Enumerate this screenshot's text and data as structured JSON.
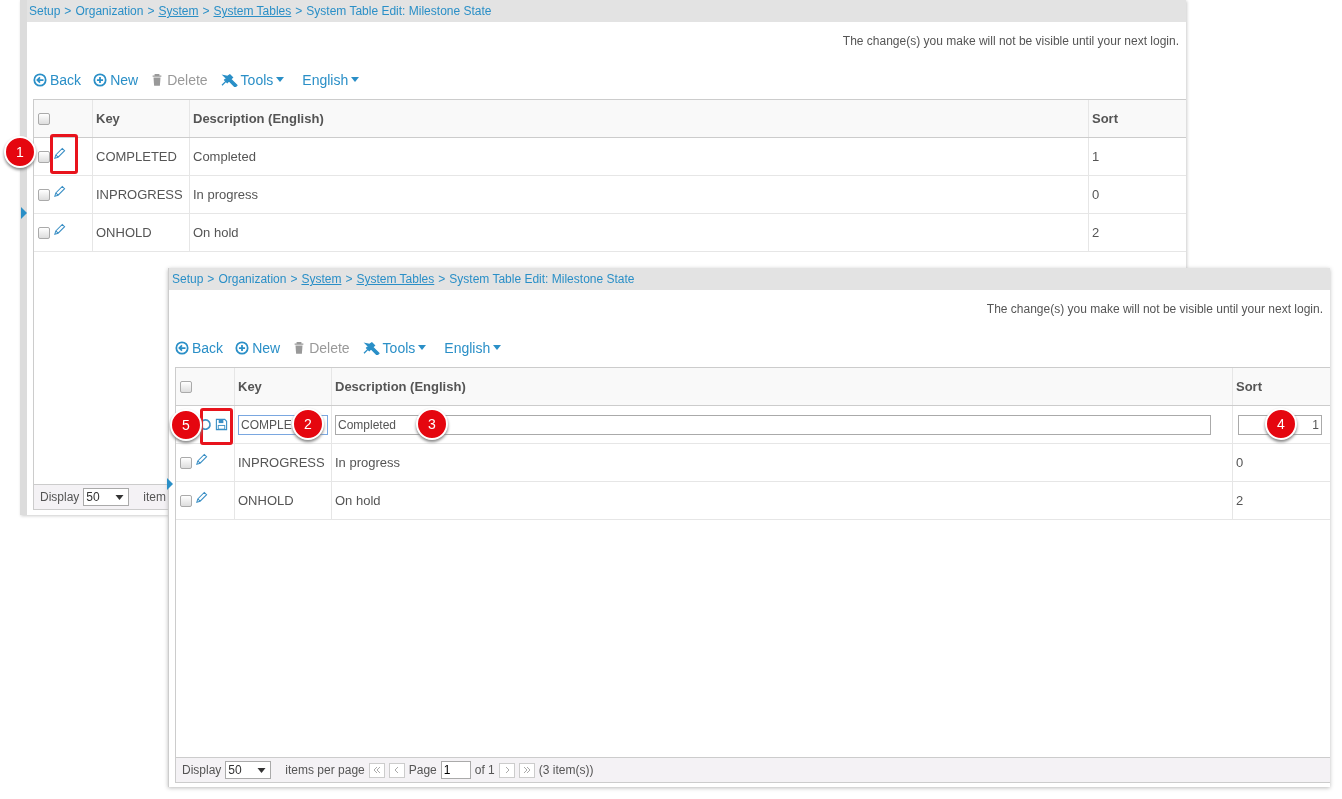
{
  "panels": [
    {
      "breadcrumb": [
        {
          "kind": "plain",
          "text": "Setup"
        },
        {
          "kind": "sep",
          "text": ">"
        },
        {
          "kind": "plain",
          "text": "Organization"
        },
        {
          "kind": "sep",
          "text": ">"
        },
        {
          "kind": "link",
          "text": "System"
        },
        {
          "kind": "sep",
          "text": ">"
        },
        {
          "kind": "link",
          "text": "System Tables"
        },
        {
          "kind": "sep",
          "text": ">"
        },
        {
          "kind": "plain",
          "text": "System Table Edit: Milestone State"
        }
      ],
      "notice": "The change(s) you make will not be visible until your next login.",
      "toolbar": [
        {
          "kind": "back",
          "label": "Back",
          "disabled": false
        },
        {
          "kind": "new",
          "label": "New",
          "disabled": false
        },
        {
          "kind": "delete",
          "label": "Delete",
          "disabled": true
        },
        {
          "kind": "tools",
          "label": "Tools",
          "disabled": false
        },
        {
          "kind": "language",
          "label": "English",
          "disabled": false
        }
      ],
      "columns": [
        "Key",
        "Description (English)",
        "Sort"
      ],
      "select_all_checked": false,
      "rows": [
        {
          "kind": "view",
          "checked": false,
          "key": "COMPLETED",
          "description": "Completed",
          "sort": "1"
        },
        {
          "kind": "view",
          "checked": false,
          "key": "INPROGRESS",
          "description": "In progress",
          "sort": "0"
        },
        {
          "kind": "view",
          "checked": false,
          "key": "ONHOLD",
          "description": "On hold",
          "sort": "2"
        }
      ],
      "footer": {
        "display_label": "Display",
        "page_size": "50",
        "items_label": "item"
      }
    },
    {
      "breadcrumb": [
        {
          "kind": "plain",
          "text": "Setup"
        },
        {
          "kind": "sep",
          "text": ">"
        },
        {
          "kind": "plain",
          "text": "Organization"
        },
        {
          "kind": "sep",
          "text": ">"
        },
        {
          "kind": "link",
          "text": "System"
        },
        {
          "kind": "sep",
          "text": ">"
        },
        {
          "kind": "link",
          "text": "System Tables"
        },
        {
          "kind": "sep",
          "text": ">"
        },
        {
          "kind": "plain",
          "text": "System Table Edit: Milestone State"
        }
      ],
      "notice": "The change(s) you make will not be visible until your next login.",
      "toolbar": [
        {
          "kind": "back",
          "label": "Back",
          "disabled": false
        },
        {
          "kind": "new",
          "label": "New",
          "disabled": false
        },
        {
          "kind": "delete",
          "label": "Delete",
          "disabled": true
        },
        {
          "kind": "tools",
          "label": "Tools",
          "disabled": false
        },
        {
          "kind": "language",
          "label": "English",
          "disabled": false
        }
      ],
      "columns": [
        "Key",
        "Description (English)",
        "Sort"
      ],
      "select_all_checked": false,
      "rows": [
        {
          "kind": "edit",
          "key": "COMPLE",
          "description": "Completed",
          "sort": "1"
        },
        {
          "kind": "view",
          "checked": false,
          "key": "INPROGRESS",
          "description": "In progress",
          "sort": "0"
        },
        {
          "kind": "view",
          "checked": false,
          "key": "ONHOLD",
          "description": "On hold",
          "sort": "2"
        }
      ],
      "footer": {
        "display_label": "Display",
        "page_size": "50",
        "items_label": "items per page",
        "page_label": "Page",
        "page_value": "1",
        "of_label": "of 1",
        "count": "(3 item(s))"
      }
    }
  ],
  "callouts": [
    "1",
    "5",
    "2",
    "3",
    "4"
  ]
}
